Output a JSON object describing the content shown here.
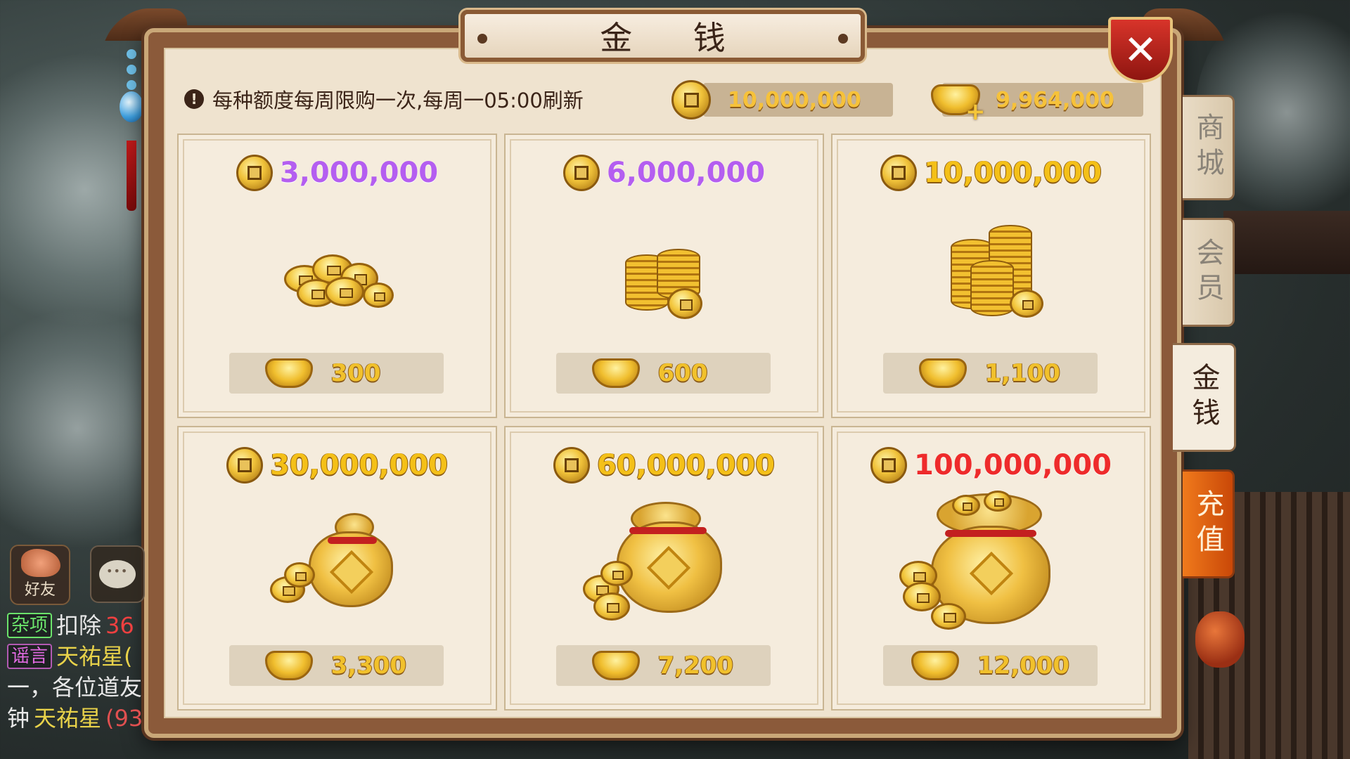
{
  "dialog": {
    "title": "金 钱",
    "notice": "每种额度每周限购一次,每周一05:00刷新",
    "coin_balance": "10,000,000",
    "ingot_balance": "9,964,000"
  },
  "packages": [
    {
      "coins": "3,000,000",
      "cost": "300",
      "price_color": "purple",
      "art": "coins-small"
    },
    {
      "coins": "6,000,000",
      "cost": "600",
      "price_color": "purple",
      "art": "coin-stacks"
    },
    {
      "coins": "10,000,000",
      "cost": "1,100",
      "price_color": "gold",
      "art": "coin-stacks-large"
    },
    {
      "coins": "30,000,000",
      "cost": "3,300",
      "price_color": "gold",
      "art": "money-bag-small"
    },
    {
      "coins": "60,000,000",
      "cost": "7,200",
      "price_color": "gold",
      "art": "money-bag-medium"
    },
    {
      "coins": "100,000,000",
      "cost": "12,000",
      "price_color": "red",
      "art": "money-bag-large"
    }
  ],
  "tabs": [
    {
      "label": "商城",
      "state": "inactive"
    },
    {
      "label": "会员",
      "state": "inactive"
    },
    {
      "label": "金钱",
      "state": "active"
    },
    {
      "label": "充值",
      "state": "highlight"
    }
  ],
  "side": {
    "friend_label": "好友"
  },
  "chat": [
    {
      "tag": "杂项",
      "text": "扣除",
      "extra": "36"
    },
    {
      "tag": "谣言",
      "text": "天祐星("
    },
    {
      "text": "一，各位道友"
    },
    {
      "text": "钟",
      "name": "天祐星",
      "extra": "(93"
    }
  ],
  "colors": {
    "purple": "#b45ef0",
    "gold": "#f4c018",
    "red": "#ee2b2b",
    "recharge_tab": "#e06a12"
  }
}
